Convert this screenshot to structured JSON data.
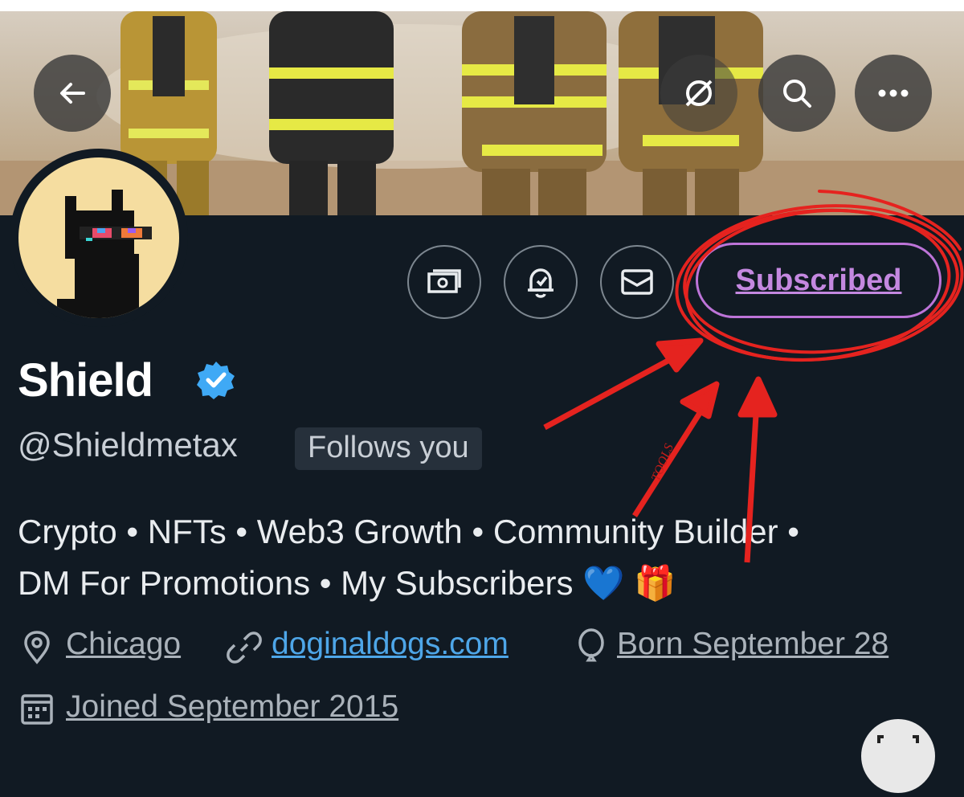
{
  "nav": {
    "back_icon": "arrow-left-icon",
    "repost_icon": "no-repost-icon",
    "search_icon": "search-icon",
    "more_icon": "more-dots-icon"
  },
  "profile": {
    "name": "Shield",
    "handle": "@Shieldmetax",
    "follows_badge": "Follows you",
    "bio_line1": "Crypto • NFTs • Web3 Growth • Community Builder •",
    "bio_line2": "DM For Promotions • My Subscribers 💙 🎁",
    "location": "Chicago",
    "website": "doginaldogs.com",
    "birthday": "Born September 28",
    "joined": "Joined September 2015"
  },
  "actions": {
    "subscribed_label": "Subscribed",
    "tip_icon": "money-icon",
    "notify_icon": "bell-check-icon",
    "message_icon": "envelope-icon"
  },
  "colors": {
    "background": "#111a23",
    "subscribed_accent": "#bd74d8",
    "annotation_red": "#e5231f",
    "link_blue": "#4ea6e8",
    "verified_blue": "#3fa9f5"
  }
}
